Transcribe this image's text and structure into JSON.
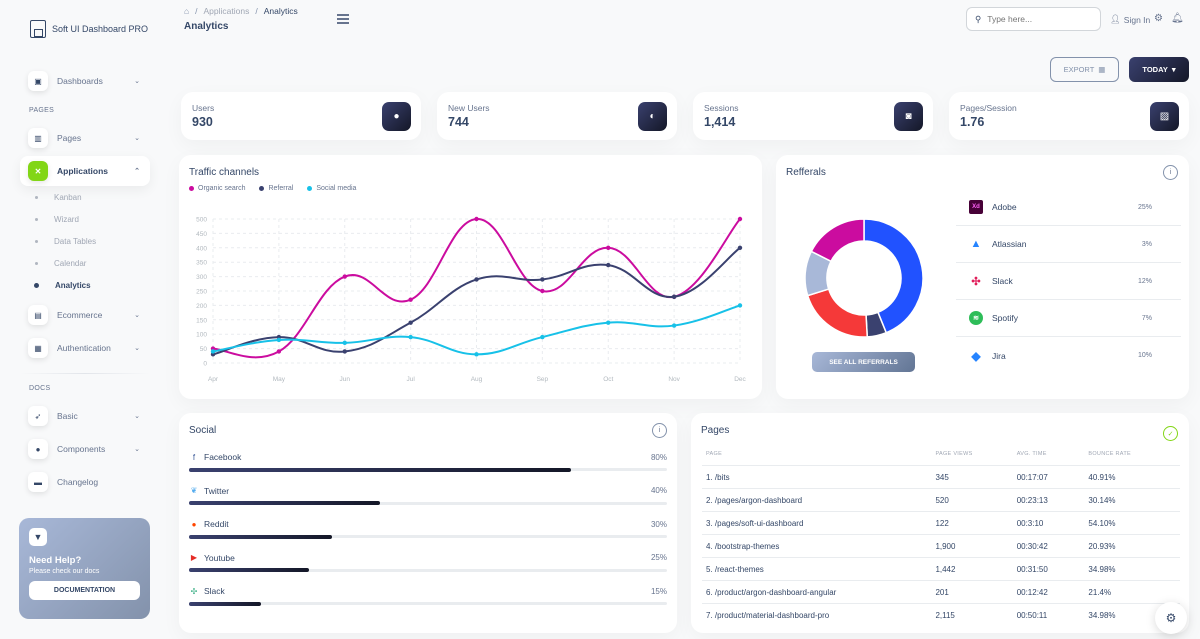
{
  "brand": {
    "name": "Soft UI Dashboard PRO"
  },
  "sidebar": {
    "items": [
      {
        "label": "Dashboards",
        "icon": "shop-icon"
      },
      {
        "label": "Pages",
        "icon": "chart-icon"
      },
      {
        "label": "Applications",
        "icon": "tools-icon"
      },
      {
        "label": "Ecommerce",
        "icon": "basket-icon"
      },
      {
        "label": "Authentication",
        "icon": "document-icon"
      },
      {
        "label": "Basic",
        "icon": "rocket-icon"
      },
      {
        "label": "Components",
        "icon": "box-icon"
      },
      {
        "label": "Changelog",
        "icon": "card-icon"
      }
    ],
    "sections": {
      "pages": "PAGES",
      "docs": "DOCS"
    },
    "sub_items": [
      "Kanban",
      "Wizard",
      "Data Tables",
      "Calendar",
      "Analytics"
    ],
    "help": {
      "title": "Need Help?",
      "subtitle": "Please check our docs",
      "button": "DOCUMENTATION"
    }
  },
  "header": {
    "breadcrumb": [
      "Applications",
      "Analytics"
    ],
    "title": "Analytics",
    "search_placeholder": "Type here...",
    "signin": "Sign In",
    "export": "EXPORT",
    "today": "TODAY"
  },
  "stats": [
    {
      "label": "Users",
      "value": "930",
      "icon": "user-icon"
    },
    {
      "label": "New Users",
      "value": "744",
      "icon": "globe-icon"
    },
    {
      "label": "Sessions",
      "value": "1,414",
      "icon": "watch-icon"
    },
    {
      "label": "Pages/Session",
      "value": "1.76",
      "icon": "image-icon"
    }
  ],
  "traffic": {
    "title": "Traffic channels"
  },
  "referrals": {
    "title": "Refferals",
    "button": "SEE ALL REFERRALS",
    "items": [
      {
        "name": "Adobe",
        "pct": "25%",
        "color": "#2152ff"
      },
      {
        "name": "Atlassian",
        "pct": "3%",
        "color": "#3a416f"
      },
      {
        "name": "Slack",
        "pct": "12%",
        "color": "#f53939"
      },
      {
        "name": "Spotify",
        "pct": "7%",
        "color": "#a8b8d8"
      },
      {
        "name": "Jira",
        "pct": "10%",
        "color": "#cb0c9f"
      }
    ]
  },
  "social": {
    "title": "Social",
    "items": [
      {
        "name": "Facebook",
        "pct": "80%",
        "value": 80,
        "color": "#3b5998"
      },
      {
        "name": "Twitter",
        "pct": "40%",
        "value": 40,
        "color": "#55acee"
      },
      {
        "name": "Reddit",
        "pct": "30%",
        "value": 30,
        "color": "#ff4500"
      },
      {
        "name": "Youtube",
        "pct": "25%",
        "value": 25,
        "color": "#e52d27"
      },
      {
        "name": "Slack",
        "pct": "15%",
        "value": 15,
        "color": "#3aaf85"
      }
    ]
  },
  "pages": {
    "title": "Pages",
    "columns": [
      "PAGE",
      "PAGE VIEWS",
      "AVG. TIME",
      "BOUNCE RATE"
    ],
    "rows": [
      [
        "1. /bits",
        "345",
        "00:17:07",
        "40.91%"
      ],
      [
        "2. /pages/argon-dashboard",
        "520",
        "00:23:13",
        "30.14%"
      ],
      [
        "3. /pages/soft-ui-dashboard",
        "122",
        "00:3:10",
        "54.10%"
      ],
      [
        "4. /bootstrap-themes",
        "1,900",
        "00:30:42",
        "20.93%"
      ],
      [
        "5. /react-themes",
        "1,442",
        "00:31:50",
        "34.98%"
      ],
      [
        "6. /product/argon-dashboard-angular",
        "201",
        "00:12:42",
        "21.4%"
      ],
      [
        "7. /product/material-dashboard-pro",
        "2,115",
        "00:50:11",
        "34.98%"
      ]
    ]
  },
  "chart_data": [
    {
      "type": "line",
      "title": "Traffic channels",
      "categories": [
        "Apr",
        "May",
        "Jun",
        "Jul",
        "Aug",
        "Sep",
        "Oct",
        "Nov",
        "Dec"
      ],
      "ylim": [
        0,
        500
      ],
      "yticks": [
        0,
        50,
        100,
        150,
        200,
        250,
        300,
        350,
        400,
        450,
        500
      ],
      "grid": true,
      "legend": "top-left",
      "series": [
        {
          "name": "Organic search",
          "color": "#cb0c9f",
          "values": [
            50,
            40,
            300,
            220,
            500,
            250,
            400,
            230,
            500
          ]
        },
        {
          "name": "Referral",
          "color": "#3a416f",
          "values": [
            30,
            90,
            40,
            140,
            290,
            290,
            340,
            230,
            400
          ]
        },
        {
          "name": "Social media",
          "color": "#17c1e8",
          "values": [
            40,
            80,
            70,
            90,
            30,
            90,
            140,
            130,
            200
          ]
        }
      ]
    },
    {
      "type": "pie",
      "title": "Refferals",
      "categories": [
        "Adobe",
        "Atlassian",
        "Slack",
        "Spotify",
        "Jira"
      ],
      "values": [
        25,
        3,
        12,
        7,
        10
      ]
    }
  ]
}
